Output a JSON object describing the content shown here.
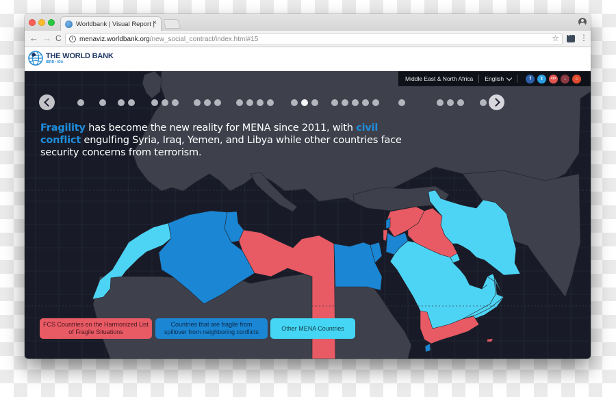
{
  "browser": {
    "tab": {
      "title": "Worldbank | Visual Report | W",
      "close_label": "×",
      "favicon": "worldbank-globe-icon"
    },
    "nav": {
      "back_icon": "←",
      "forward_icon": "→",
      "reload_icon": "C"
    },
    "address_bar": {
      "info_icon": "i",
      "host": "menaviz.worldbank.org",
      "path": "/new_social_contract/index.html#15"
    },
    "bookmark_icon": "☆",
    "menu_icon": "⋮"
  },
  "site": {
    "logo": {
      "name": "THE WORLD BANK",
      "sub": "IBRD • IDA"
    }
  },
  "topbar": {
    "region": "Middle East & North Africa",
    "language": "English",
    "social": [
      {
        "name": "facebook",
        "glyph": "f"
      },
      {
        "name": "twitter",
        "glyph": "t"
      },
      {
        "name": "embed",
        "glyph": "</>"
      },
      {
        "name": "download",
        "glyph": "↓"
      },
      {
        "name": "home",
        "glyph": "⌂"
      }
    ]
  },
  "pager": {
    "groups": [
      1,
      1,
      2,
      3,
      3,
      4,
      3,
      5,
      1,
      3,
      1
    ],
    "active_group": 6,
    "active_index_in_group": 1
  },
  "headline": {
    "highlight1": "Fragility",
    "text1": " has become the new reality for MENA since 2011, with ",
    "highlight2": "civil conflict",
    "text2": " engulfing Syria, Iraq, Yemen, and Libya while other countries face security concerns from terrorism."
  },
  "legend": {
    "fcs": {
      "line1": "FCS Countries on the Harmonized List",
      "line2": "of Fragile Situations",
      "color": "#e85a64"
    },
    "spillover": {
      "line1": "Countries that are fragile from",
      "line2": "spillover from neighboring conflicts",
      "color": "#1a86d4"
    },
    "other": {
      "line1": "Other MENA Countries",
      "color": "#44d6f4"
    }
  },
  "map": {
    "colors": {
      "ocean": "#181b27",
      "land": "#3e404c",
      "border": "#23252f",
      "fcs": "#e85a64",
      "spillover": "#1a86d4",
      "other": "#4dd4f4"
    },
    "fcs_countries": [
      "Libya",
      "Syria",
      "Iraq",
      "Yemen"
    ],
    "spillover_countries": [
      "Algeria",
      "Tunisia",
      "Egypt",
      "Jordan",
      "Lebanon",
      "Djibouti"
    ],
    "other_countries": [
      "Morocco",
      "Saudi Arabia",
      "Iran",
      "Kuwait",
      "Oman",
      "UAE",
      "Qatar",
      "Bahrain"
    ]
  }
}
